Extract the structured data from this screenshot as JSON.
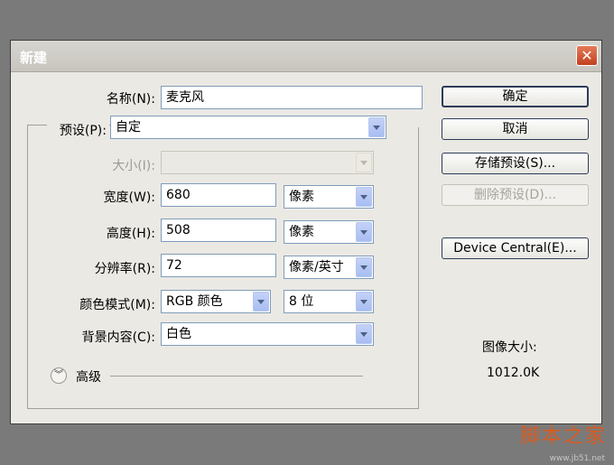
{
  "dialog": {
    "title": "新建",
    "close_glyph": "✕"
  },
  "fields": {
    "name_label": "名称(N):",
    "name_value": "麦克风",
    "preset_label": "预设(P):",
    "preset_value": "自定",
    "size_label": "大小(I):",
    "size_value": "",
    "width_label": "宽度(W):",
    "width_value": "680",
    "width_unit": "像素",
    "height_label": "高度(H):",
    "height_value": "508",
    "height_unit": "像素",
    "resolution_label": "分辨率(R):",
    "resolution_value": "72",
    "resolution_unit": "像素/英寸",
    "color_mode_label": "颜色模式(M):",
    "color_mode_value": "RGB 颜色",
    "bit_depth_value": "8 位",
    "background_label": "背景内容(C):",
    "background_value": "白色",
    "advanced_label": "高级"
  },
  "buttons": {
    "ok": "确定",
    "cancel": "取消",
    "save_preset": "存储预设(S)...",
    "delete_preset": "删除预设(D)...",
    "device_central": "Device Central(E)..."
  },
  "image_size": {
    "label": "图像大小:",
    "value": "1012.0K"
  },
  "watermark": {
    "text": "脚本之家",
    "url": "www.jb51.net"
  },
  "colors": {
    "accent_border": "#2c3c5a",
    "dropdown_blue": "#a8bef2",
    "close_red": "#c3401f"
  }
}
